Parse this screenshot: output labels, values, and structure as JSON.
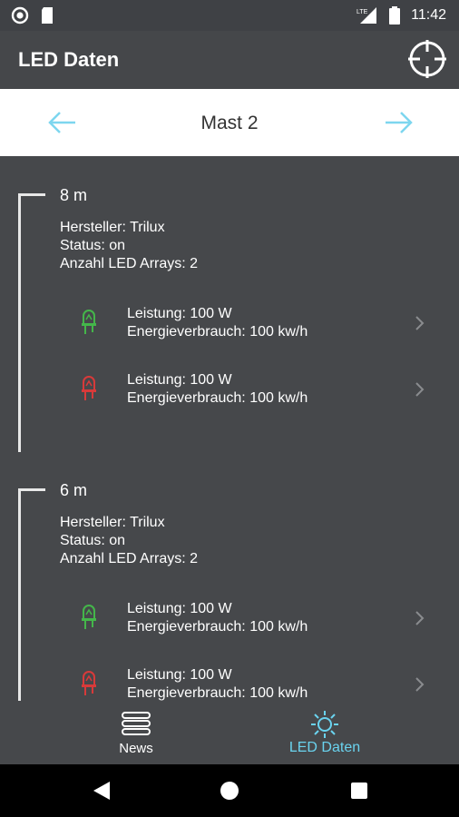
{
  "status_bar": {
    "time": "11:42",
    "signal_label": "LTE"
  },
  "app_bar": {
    "title": "LED Daten",
    "locate_icon": "crosshair-icon"
  },
  "mast_nav": {
    "title": "Mast 2",
    "prev_icon": "arrow-left-icon",
    "next_icon": "arrow-right-icon",
    "arrow_color": "#7dd6ef"
  },
  "groups": [
    {
      "height": "8 m",
      "manufacturer": "Hersteller: Trilux",
      "status": "Status: on",
      "array_count": "Anzahl LED Arrays: 2",
      "arrays": [
        {
          "power": "Leistung: 100 W",
          "energy": "Energieverbrauch: 100 kw/h",
          "led_color": "#44b64a"
        },
        {
          "power": "Leistung: 100 W",
          "energy": "Energieverbrauch: 100 kw/h",
          "led_color": "#d83a3a"
        }
      ]
    },
    {
      "height": "6 m",
      "manufacturer": "Hersteller: Trilux",
      "status": "Status: on",
      "array_count": "Anzahl LED Arrays: 2",
      "arrays": [
        {
          "power": "Leistung: 100 W",
          "energy": "Energieverbrauch: 100 kw/h",
          "led_color": "#44b64a"
        },
        {
          "power": "Leistung: 100 W",
          "energy": "Energieverbrauch: 100 kw/h",
          "led_color": "#d83a3a"
        }
      ]
    }
  ],
  "bottom_nav": {
    "news_label": "News",
    "led_label": "LED Daten",
    "active": "LED Daten",
    "active_color": "#6ad3ef"
  }
}
